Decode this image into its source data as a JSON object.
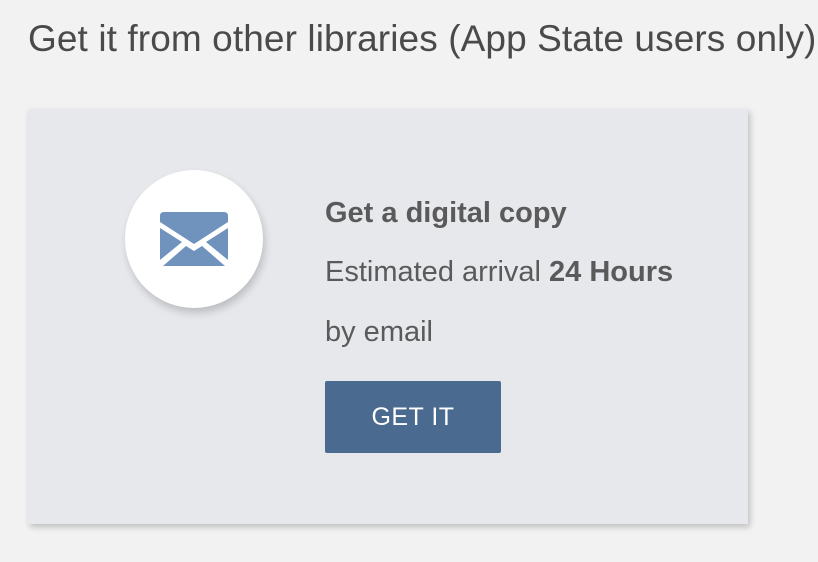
{
  "section": {
    "heading": "Get it from other libraries (App State users only)"
  },
  "option": {
    "icon": "envelope-icon",
    "title": "Get a digital copy",
    "arrival_prefix": "Estimated arrival",
    "arrival_value": "24 Hours",
    "delivery": "by email",
    "button_label": "GET IT"
  },
  "colors": {
    "page_background": "#f2f2f2",
    "card_background": "#e6e8ec",
    "icon_color": "#6f93bd",
    "button_background": "#4a6a90",
    "button_text": "#ffffff",
    "text": "#5a5a5a"
  }
}
